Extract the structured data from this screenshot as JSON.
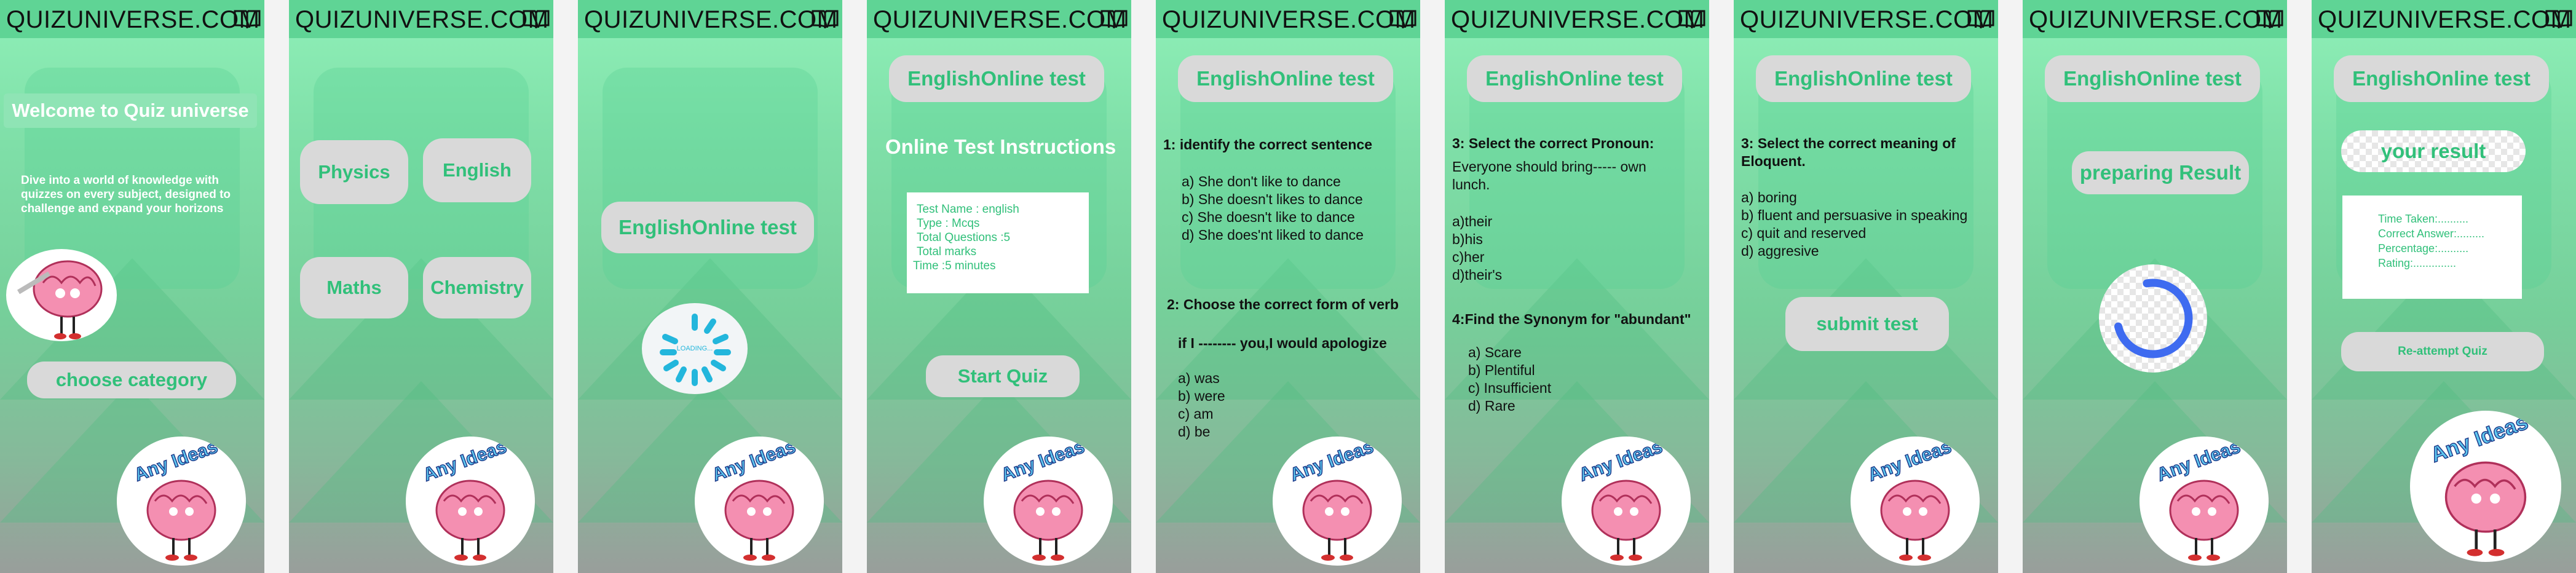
{
  "app": {
    "title": "QUIZUNIVERSE.COM",
    "icon": "book-icon"
  },
  "colors": {
    "header": "#5fd495",
    "accent_text": "#31c07a",
    "button_bg": "#d9d9d9",
    "loader_blue": "#3e6bf0",
    "spinner_teal": "#23b6dc"
  },
  "sticker": {
    "text": "Any Ideas?",
    "icon": "brain-character-icon"
  },
  "s1": {
    "welcome": "Welcome to Quiz universe",
    "desc": [
      "Dive into a world of knowledge with",
      "quizzes on every subject, designed to",
      "challenge and expand your horizons"
    ],
    "cta": "choose category"
  },
  "s2": {
    "categories": [
      "Physics",
      "English",
      "Maths",
      "Chemistry"
    ]
  },
  "s3": {
    "test_button": "EnglishOnline test",
    "loading": "LOADING..."
  },
  "s4": {
    "header_button": "EnglishOnline test",
    "heading": "Online Test Instructions",
    "info": [
      "Test Name : english",
      "Type : Mcqs",
      "Total Questions :5",
      "Total marks",
      "Time :5 minutes"
    ],
    "start": "Start Quiz"
  },
  "s5": {
    "header_button": "EnglishOnline test",
    "q1": "1: identify the correct sentence",
    "q1_options": [
      "a) She don't like to dance",
      "b) She doesn't likes to dance",
      "c) She doesn't like to dance",
      "d) She does'nt liked to dance"
    ],
    "q2": "2: Choose the correct form of verb",
    "q2_stem": "if I -------- you,I would apologize",
    "q2_options": [
      "a) was",
      "b) were",
      "c) am",
      "d) be"
    ]
  },
  "s6": {
    "header_button": "EnglishOnline test",
    "q3": "3: Select the correct Pronoun:",
    "q3_stem": [
      "Everyone should bring----- own",
      "lunch."
    ],
    "q3_options": [
      "a)their",
      "b)his",
      "c)her",
      "d)their's"
    ],
    "q4": "4:Find the Synonym for \"abundant\"",
    "q4_options": [
      "a) Scare",
      "b) Plentiful",
      "c) Insufficient",
      "d) Rare"
    ]
  },
  "s7": {
    "header_button": "EnglishOnline test",
    "q5": [
      "3: Select the correct meaning of",
      "Eloquent."
    ],
    "q5_options": [
      "a) boring",
      "b) fluent and persuasive in speaking",
      "c) quit and reserved",
      "d) aggresive"
    ],
    "submit": "submit test"
  },
  "s8": {
    "header_button": "EnglishOnline test",
    "status": "preparing Result"
  },
  "s9": {
    "header_button": "EnglishOnline test",
    "result_title": "your result",
    "lines": [
      "Time Taken:..........",
      "Correct Answer:.........",
      "Percentage:..........",
      "Rating:.............."
    ],
    "reattempt": "Re-attempt Quiz"
  }
}
